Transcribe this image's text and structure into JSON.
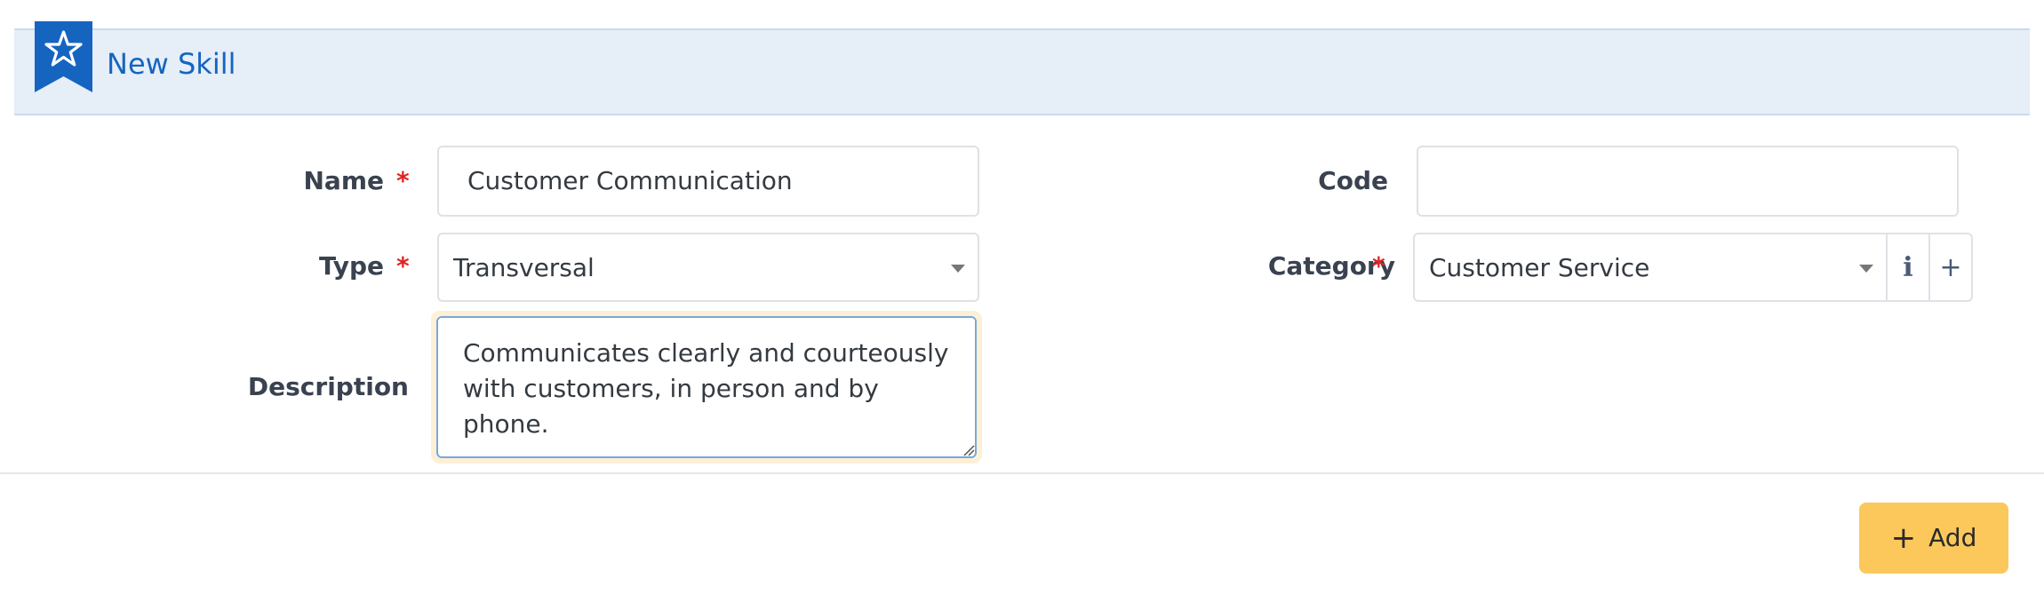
{
  "header": {
    "title": "New Skill"
  },
  "form": {
    "name": {
      "label": "Name",
      "required_mark": "*",
      "value": "Customer Communication"
    },
    "code": {
      "label": "Code",
      "value": ""
    },
    "type": {
      "label": "Type",
      "required_mark": "*",
      "value": "Transversal"
    },
    "category": {
      "label": "Category",
      "required_mark": "*",
      "value": "Customer Service",
      "info_glyph": "i",
      "add_glyph": "+"
    },
    "description": {
      "label": "Description",
      "value": "Communicates clearly and courteously\nwith customers, in person and by phone."
    }
  },
  "actions": {
    "add_label": "Add",
    "add_glyph": "+"
  },
  "colors": {
    "header_bg": "#e6eef8",
    "brand_blue": "#1565c0",
    "required_red": "#e02424",
    "add_button_bg": "#fcc85c"
  },
  "icons": {
    "header": "star-ribbon-icon"
  }
}
